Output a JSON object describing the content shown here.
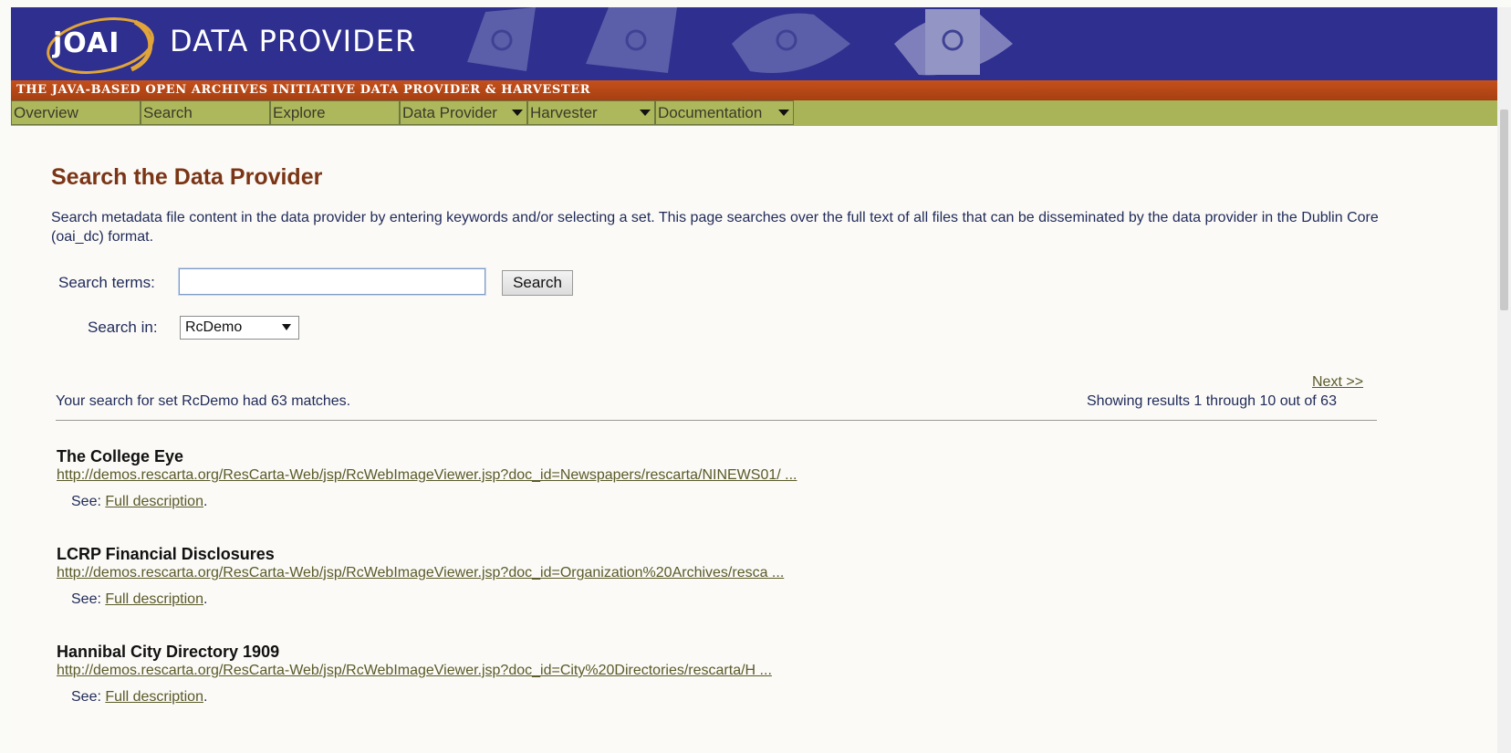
{
  "banner": {
    "logo": "jOAI",
    "title": "DATA PROVIDER",
    "subtitle": "THE JAVA-BASED OPEN ARCHIVES INITIATIVE DATA PROVIDER & HARVESTER"
  },
  "nav": {
    "items": [
      {
        "label": "Overview",
        "dropdown": false
      },
      {
        "label": "Search",
        "dropdown": false
      },
      {
        "label": "Explore",
        "dropdown": false
      },
      {
        "label": "Data Provider",
        "dropdown": true
      },
      {
        "label": "Harvester",
        "dropdown": true
      },
      {
        "label": "Documentation",
        "dropdown": true
      }
    ]
  },
  "main": {
    "page_title": "Search the Data Provider",
    "intro": "Search metadata file content in the data provider by entering keywords and/or selecting a set. This page searches over the full text of all files that can be disseminated by the data provider in the Dublin Core (oai_dc) format.",
    "search_terms_label": "Search terms:",
    "search_value": "",
    "search_button": "Search",
    "search_in_label": "Search in:",
    "search_in_selected": "RcDemo",
    "match_text": "Your search for set RcDemo had 63 matches.",
    "next_link": "Next >>",
    "showing_text": "Showing results 1 through 10 out of 63"
  },
  "results": [
    {
      "title": "The College Eye",
      "url": "http://demos.rescarta.org/ResCarta-Web/jsp/RcWebImageViewer.jsp?doc_id=Newspapers/rescarta/NINEWS01/ ...",
      "see_label": "See:",
      "link_label": "Full description",
      "period": "."
    },
    {
      "title": "LCRP Financial Disclosures",
      "url": "http://demos.rescarta.org/ResCarta-Web/jsp/RcWebImageViewer.jsp?doc_id=Organization%20Archives/resca ...",
      "see_label": "See:",
      "link_label": "Full description",
      "period": "."
    },
    {
      "title": "Hannibal City Directory 1909",
      "url": "http://demos.rescarta.org/ResCarta-Web/jsp/RcWebImageViewer.jsp?doc_id=City%20Directories/rescarta/H ...",
      "see_label": "See:",
      "link_label": "Full description",
      "period": "."
    }
  ],
  "colors": {
    "banner_bg": "#2e2f8e",
    "subbar_bg": "#b84a17",
    "nav_bg": "#a9b458",
    "title_color": "#7b3516",
    "text_color": "#1f2a5a",
    "link_color": "#5a5a2a"
  }
}
